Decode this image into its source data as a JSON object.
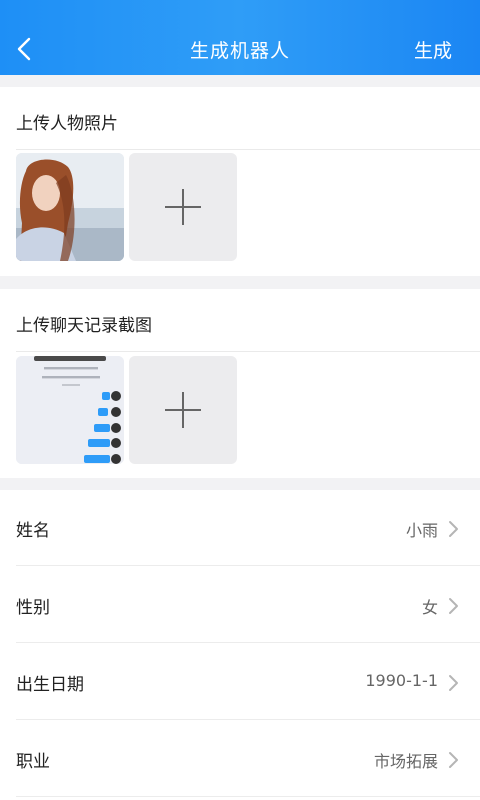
{
  "header": {
    "title": "生成机器人",
    "action_label": "生成",
    "back_icon": "chevron-left-icon"
  },
  "upload_photos": {
    "title": "上传人物照片",
    "add_icon": "plus-icon"
  },
  "upload_chats": {
    "title": "上传聊天记录截图",
    "add_icon": "plus-icon"
  },
  "profile": {
    "rows": [
      {
        "label": "姓名",
        "value": "小雨"
      },
      {
        "label": "性别",
        "value": "女"
      },
      {
        "label": "出生日期",
        "value": "1990-1-1"
      },
      {
        "label": "职业",
        "value": "市场拓展"
      }
    ]
  },
  "colors": {
    "header_blue": "#1e8ff6",
    "chat_bubble_blue": "#2e9cf8"
  }
}
